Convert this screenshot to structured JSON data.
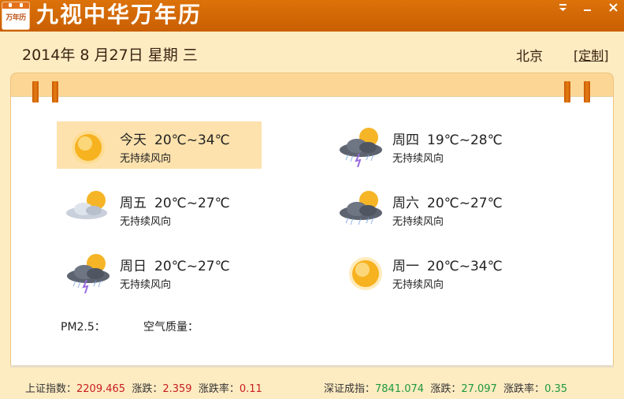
{
  "app": {
    "logo_text": "万年历",
    "title": "九视中华万年历",
    "window_buttons": {
      "menu_icon": "menu-dropdown-icon",
      "minimize_icon": "minimize-icon",
      "close_icon": "close-icon"
    }
  },
  "header": {
    "date": "2014年 8 月27日",
    "weekday": "星期 三",
    "city": "北京",
    "customize_label": "[定制]"
  },
  "forecast": [
    {
      "day": "今天",
      "temp": "20℃~34℃",
      "wind": "无持续风向",
      "icon": "sunny-icon",
      "selected": true
    },
    {
      "day": "周四",
      "temp": "19℃~28℃",
      "wind": "无持续风向",
      "icon": "thunderstorm-icon",
      "selected": false
    },
    {
      "day": "周五",
      "temp": "20℃~27℃",
      "wind": "无持续风向",
      "icon": "partly-cloudy-icon",
      "selected": false
    },
    {
      "day": "周六",
      "temp": "20℃~27℃",
      "wind": "无持续风向",
      "icon": "thunderstorm-icon",
      "selected": false
    },
    {
      "day": "周日",
      "temp": "20℃~27℃",
      "wind": "无持续风向",
      "icon": "thunderstorm-icon",
      "selected": false
    },
    {
      "day": "周一",
      "temp": "20℃~34℃",
      "wind": "无持续风向",
      "icon": "sunny-icon",
      "selected": false
    }
  ],
  "air": {
    "pm25_label": "PM2.5：",
    "quality_label": "空气质量："
  },
  "stocks": {
    "shanghai": {
      "name_label": "上证指数：",
      "index": "2209.465",
      "change_label": "涨跌：",
      "change": "2.359",
      "rate_label": "涨跌率：",
      "rate": "0.11"
    },
    "shenzhen": {
      "name_label": "深证成指：",
      "index": "7841.074",
      "change_label": "涨跌：",
      "change": "27.097",
      "rate_label": "涨跌率：",
      "rate": "0.35"
    }
  },
  "colors": {
    "titlebar": "#d66a05",
    "stock_up": "#c81e1e",
    "stock_down": "#1e9a3c",
    "selected_day_bg": "#fde2ad"
  }
}
